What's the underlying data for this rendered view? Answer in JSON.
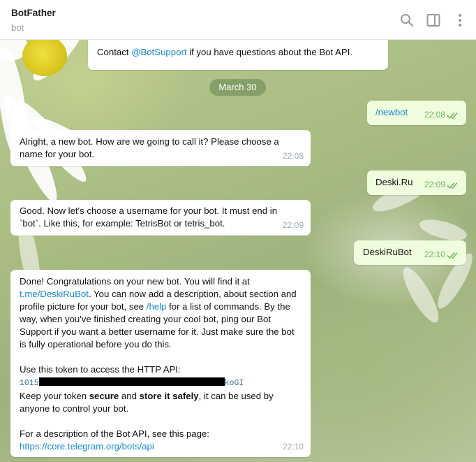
{
  "header": {
    "title": "BotFather",
    "subtitle": "bot",
    "icons": [
      "search-icon",
      "sidebar-toggle-icon",
      "more-vertical-icon"
    ]
  },
  "chat": {
    "top_message": {
      "prefix": "Contact ",
      "link": "@BotSupport",
      "suffix": " if you have questions about the Bot API."
    },
    "date_separator": "March 30",
    "messages": [
      {
        "id": "m1",
        "direction": "out",
        "text": "/newbot",
        "time": "22:08",
        "is_command": true
      },
      {
        "id": "m2",
        "direction": "in",
        "lines": [
          "Alright, a new bot. How are we going to call it? Please choose a",
          "name for your bot."
        ],
        "time": "22:08"
      },
      {
        "id": "m3",
        "direction": "out",
        "text": "Deski.Ru",
        "time": "22:09"
      },
      {
        "id": "m4",
        "direction": "in",
        "lines": [
          "Good. Now let's choose a username for your bot. It must end in",
          "`bot`. Like this, for example: TetrisBot or tetris_bot."
        ],
        "time": "22:09"
      },
      {
        "id": "m5",
        "direction": "out",
        "text": "DeskiRuBot",
        "time": "22:10"
      },
      {
        "id": "m6",
        "direction": "in",
        "time": "22:10",
        "p1_line1": "Done! Congratulations on your new bot. You will find it at",
        "p1_link": "t.me/DeskiRuBot",
        "p1_line2_rest": ". You can now add a description, about section and",
        "p1_line3_pre": "profile picture for your bot, see ",
        "p1_help_link": "/help",
        "p1_line3_post": " for a list of commands. By the",
        "p1_line4": "way, when you've finished creating your cool bot, ping our Bot",
        "p1_line5": "Support if you want a better username for it. Just make sure the bot",
        "p1_line6": "is fully operational before you do this.",
        "p2_line1": "Use this token to access the HTTP API:",
        "token_start": "1015",
        "token_end": "koGI",
        "p2_line3_pre": "Keep your token ",
        "p2_bold1": "secure",
        "p2_mid": " and ",
        "p2_bold2": "store it safely",
        "p2_line3_post": ", it can be used by",
        "p2_line4": "anyone to control your bot.",
        "p3_line1": "For a description of the Bot API, see this page:",
        "p3_link": "https://core.telegram.org/bots/api"
      }
    ]
  },
  "colors": {
    "link": "#168acd",
    "outgoing_bubble": "#effdde",
    "incoming_bubble": "#ffffff",
    "read_check": "#6cba5c",
    "date_pill": "#7a9660"
  }
}
